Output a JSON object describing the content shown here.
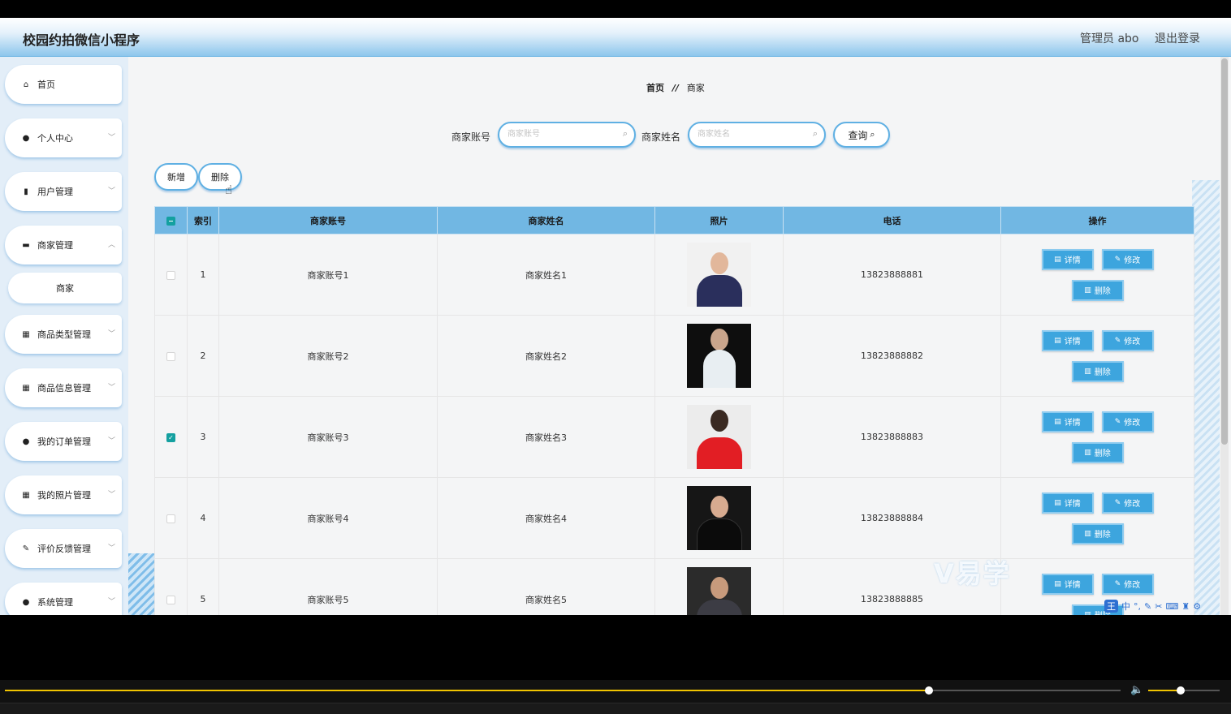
{
  "header": {
    "app_title": "校园约拍微信小程序",
    "admin_label": "管理员 abo",
    "logout": "退出登录"
  },
  "sidebar": {
    "items": [
      {
        "label": "首页",
        "icon": "home-icon",
        "glyph": "⌂",
        "has_arrow": false
      },
      {
        "label": "个人中心",
        "icon": "user-icon",
        "glyph": "●",
        "has_arrow": true
      },
      {
        "label": "用户管理",
        "icon": "clipboard-icon",
        "glyph": "▮",
        "has_arrow": true
      },
      {
        "label": "商家管理",
        "icon": "briefcase-icon",
        "glyph": "▬",
        "has_arrow": true
      },
      {
        "label": "商品类型管理",
        "icon": "grid-icon",
        "glyph": "▦",
        "has_arrow": true
      },
      {
        "label": "商品信息管理",
        "icon": "grid-icon",
        "glyph": "▦",
        "has_arrow": true
      },
      {
        "label": "我的订单管理",
        "icon": "user-icon",
        "glyph": "●",
        "has_arrow": true
      },
      {
        "label": "我的照片管理",
        "icon": "grid-icon",
        "glyph": "▦",
        "has_arrow": true
      },
      {
        "label": "评价反馈管理",
        "icon": "edit-icon",
        "glyph": "✎",
        "has_arrow": true
      },
      {
        "label": "系统管理",
        "icon": "user-icon",
        "glyph": "●",
        "has_arrow": true
      }
    ],
    "submenu": {
      "label": "商家"
    }
  },
  "breadcrumb": {
    "home": "首页",
    "separator": "//",
    "current": "商家"
  },
  "search": {
    "account_label": "商家账号",
    "account_placeholder": "商家账号",
    "name_label": "商家姓名",
    "name_placeholder": "商家姓名",
    "query_button": "查询"
  },
  "actions": {
    "add": "新增",
    "delete": "删除"
  },
  "table": {
    "columns": [
      "索引",
      "商家账号",
      "商家姓名",
      "照片",
      "电话",
      "操作"
    ],
    "rows": [
      {
        "index": "1",
        "account": "商家账号1",
        "name": "商家姓名1",
        "phone": "13823888881",
        "checked": false
      },
      {
        "index": "2",
        "account": "商家账号2",
        "name": "商家姓名2",
        "phone": "13823888882",
        "checked": false
      },
      {
        "index": "3",
        "account": "商家账号3",
        "name": "商家姓名3",
        "phone": "13823888883",
        "checked": true
      },
      {
        "index": "4",
        "account": "商家账号4",
        "name": "商家姓名4",
        "phone": "13823888884",
        "checked": false
      },
      {
        "index": "5",
        "account": "商家账号5",
        "name": "商家姓名5",
        "phone": "13823888885",
        "checked": false
      }
    ],
    "row_buttons": {
      "detail": "详情",
      "edit": "修改",
      "delete": "删除"
    }
  },
  "player": {
    "progress_fraction": 0.828,
    "volume_fraction": 0.45
  },
  "colors": {
    "table_header": "#71b7e3",
    "button": "#3da5de",
    "checkbox": "#14a0a0",
    "progress": "#f0c400"
  }
}
